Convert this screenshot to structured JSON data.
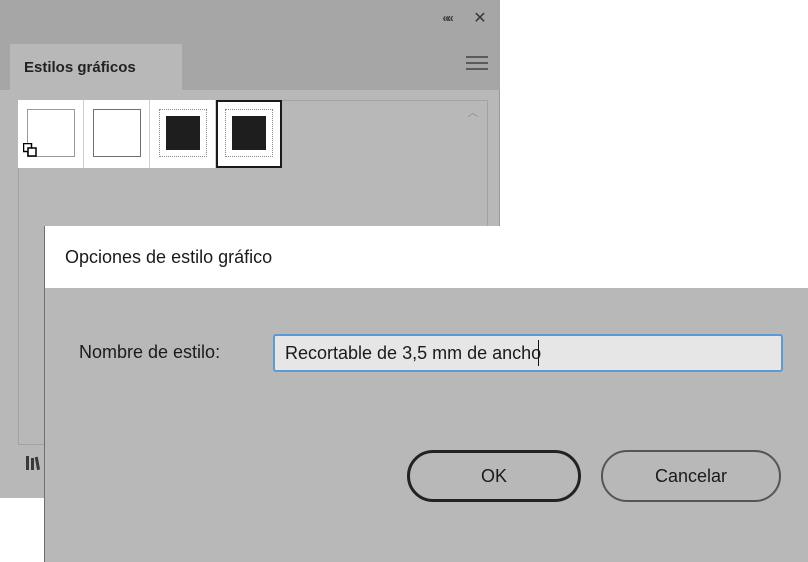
{
  "panel": {
    "collapse_glyph": "««",
    "close_glyph": "✕",
    "tab_label": "Estilos gráficos",
    "swatches": [
      {
        "icon": "default-style-icon"
      },
      {
        "icon": "blank-style-icon"
      },
      {
        "icon": "black-fill-style-icon"
      },
      {
        "icon": "black-fill-selected-style-icon"
      }
    ]
  },
  "dialog": {
    "title": "Opciones de estilo gráfico",
    "field_label": "Nombre de estilo:",
    "field_value": "Recortable de 3,5 mm de ancho",
    "ok_label": "OK",
    "cancel_label": "Cancelar"
  }
}
